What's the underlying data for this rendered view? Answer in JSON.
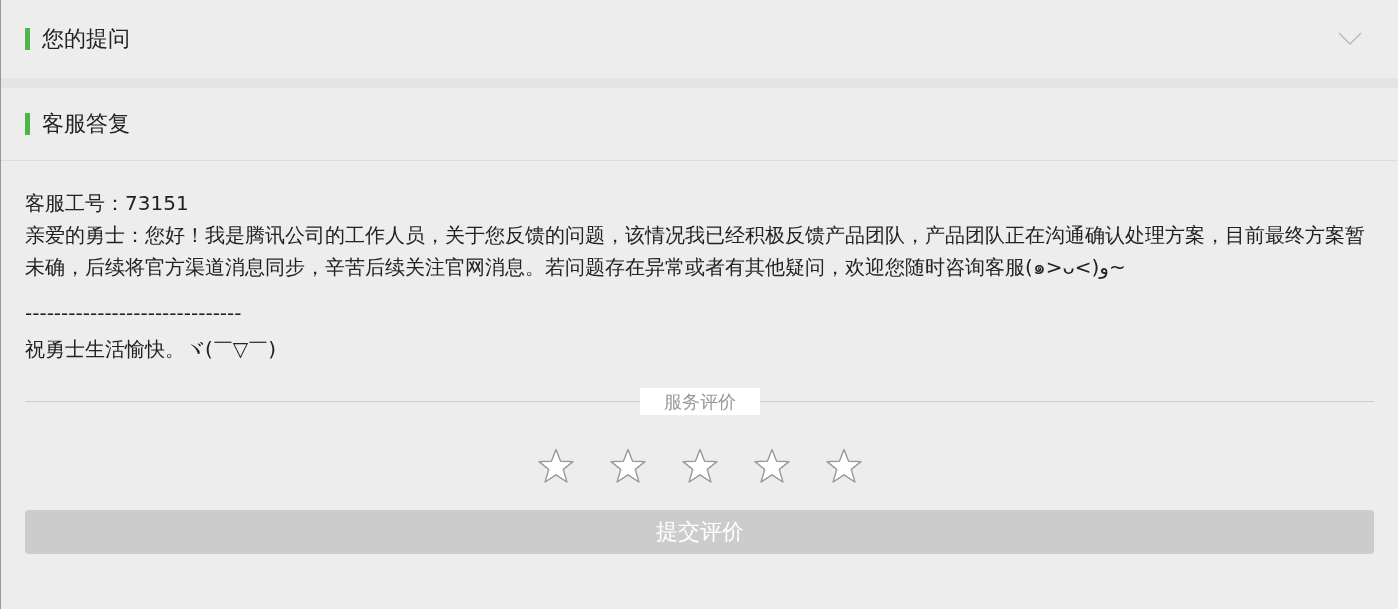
{
  "question_panel": {
    "title": "您的提问",
    "expanded": false
  },
  "answer_panel": {
    "title": "客服答复",
    "lines": [
      "客服工号：73151",
      "亲爱的勇士：您好！我是腾讯公司的工作人员，关于您反馈的问题，该情况我已经积极反馈产品团队，产品团队正在沟通确认处理方案，目前最终方案暂未确，后续将官方渠道消息同步，辛苦后续关注官网消息。若问题存在异常或者有其他疑问，欢迎您随时咨询客服(๑>ᴗ<)و~",
      "------------------------------",
      "祝勇士生活愉快。ヾ(￣▽￣)"
    ]
  },
  "rating": {
    "title": "服务评价",
    "stars": 0
  },
  "submit_button": {
    "label": "提交评价"
  }
}
